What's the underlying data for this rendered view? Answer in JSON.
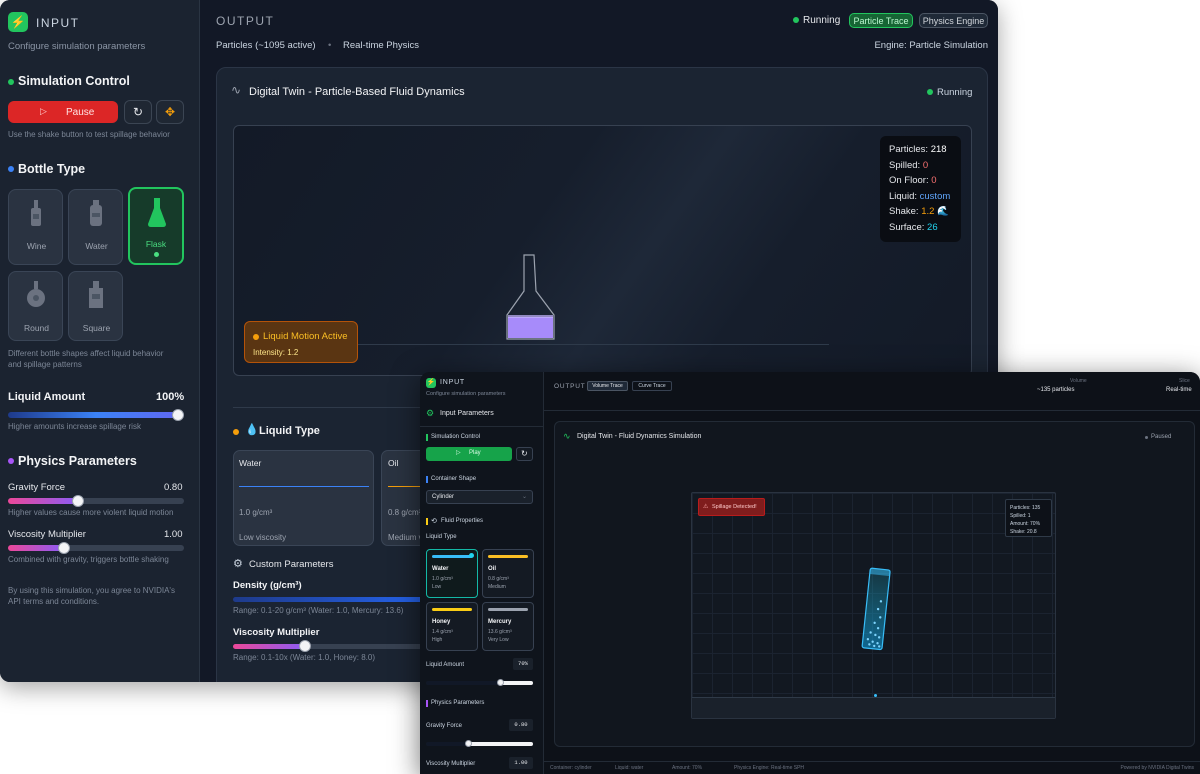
{
  "winA": {
    "sidebar": {
      "title": "INPUT",
      "subtitle": "Configure simulation parameters",
      "sim_control": {
        "heading": "Simulation Control",
        "pause_label": "Pause",
        "hint": "Use the shake button to test spillage behavior"
      },
      "bottle_type": {
        "heading": "Bottle Type",
        "items": [
          {
            "label": "Wine",
            "selected": false
          },
          {
            "label": "Water",
            "selected": false
          },
          {
            "label": "Flask",
            "selected": true
          },
          {
            "label": "Round",
            "selected": false
          },
          {
            "label": "Square",
            "selected": false
          }
        ],
        "hint_line1": "Different bottle shapes affect liquid behavior",
        "hint_line2": "and spillage patterns"
      },
      "liquid_amount": {
        "label": "Liquid Amount",
        "value": "100%",
        "fraction": 1.0,
        "hint": "Higher amounts increase spillage risk"
      },
      "physics": {
        "heading": "Physics Parameters",
        "gravity_label": "Gravity Force",
        "gravity_value": "0.80",
        "gravity_fraction": 0.4,
        "gravity_hint": "Higher values cause more violent liquid motion",
        "viscosity_label": "Viscosity Multiplier",
        "viscosity_value": "1.00",
        "viscosity_fraction": 0.32,
        "viscosity_hint": "Combined with gravity, triggers bottle shaking"
      },
      "terms_line1": "By using this simulation, you agree to NVIDIA's",
      "terms_line2": "API terms and conditions."
    },
    "main": {
      "title": "OUTPUT",
      "status": "Running",
      "tab_particle_trace": "Particle Trace",
      "tab_physics_engine": "Physics Engine",
      "particles_info": "Particles (~1095 active)",
      "separator": "•",
      "realtime": "Real-time Physics",
      "engine": "Engine: Particle Simulation",
      "panel_title": "Digital Twin - Particle-Based Fluid Dynamics",
      "panel_status": "Running",
      "stats": {
        "particles_label": "Particles:",
        "particles_value": "218",
        "spilled_label": "Spilled:",
        "spilled_value": "0",
        "floor_label": "On Floor:",
        "floor_value": "0",
        "liquid_label": "Liquid:",
        "liquid_value": "custom",
        "shake_label": "Shake:",
        "shake_value": "1.2",
        "shake_icon": "🌊",
        "surface_label": "Surface:",
        "surface_value": "26"
      },
      "motion_title": "Liquid Motion Active",
      "motion_intensity": "Intensity: 1.2",
      "liquid_type_heading": "Liquid Type",
      "liquids": [
        {
          "name": "Water",
          "density": "1.0 g/cm³",
          "viscosity": "Low viscosity",
          "color": "#3b82f6"
        },
        {
          "name": "Oil",
          "density": "0.8 g/cm³",
          "viscosity": "Medium v",
          "color": "#f59e0b"
        }
      ],
      "custom_heading": "Custom Parameters",
      "density_label": "Density (g/cm³)",
      "density_range": "Range: 0.1-20 g/cm³ (Water: 1.0, Mercury: 13.6)",
      "visc_label": "Viscosity Multiplier",
      "visc_range": "Range: 0.1-10x (Water: 1.0, Honey: 8.0)"
    }
  },
  "winB": {
    "sidebar": {
      "title": "INPUT",
      "subtitle": "Configure simulation parameters",
      "input_params": "Input Parameters",
      "sim_control": "Simulation Control",
      "play_label": "Play",
      "container_shape": "Container Shape",
      "shape_value": "Cylinder",
      "fluid_properties": "Fluid Properties",
      "liquid_type": "Liquid Type",
      "liquids": [
        {
          "name": "Water",
          "density": "1.0 g/cm³",
          "viscosity": "Low",
          "color": "#38bdf8",
          "selected": true
        },
        {
          "name": "Oil",
          "density": "0.8 g/cm³",
          "viscosity": "Medium",
          "color": "#fbbf24",
          "selected": false
        },
        {
          "name": "Honey",
          "density": "1.4 g/cm³",
          "viscosity": "High",
          "color": "#facc15",
          "selected": false
        },
        {
          "name": "Mercury",
          "density": "13.6 g/cm³",
          "viscosity": "Very Low",
          "color": "#9ca3af",
          "selected": false
        }
      ],
      "liquid_amount": "Liquid Amount",
      "liquid_amount_value": "70%",
      "liquid_amount_fraction": 0.7,
      "physics_params": "Physics Parameters",
      "gravity_label": "Gravity Force",
      "gravity_value": "0.80",
      "gravity_fraction": 0.4,
      "viscosity_label": "Viscosity Multiplier",
      "viscosity_value": "1.00"
    },
    "main": {
      "title": "OUTPUT",
      "tab_volume": "Volume Trace",
      "tab_curve": "Curve Trace",
      "volume_label": "Volume",
      "volume_value": "~135 particles",
      "slice_label": "Slice",
      "slice_value": "Real-time",
      "panel_title": "Digital Twin - Fluid Dynamics Simulation",
      "panel_status": "Paused",
      "spillage": "Spillage Detected!",
      "stats": [
        "Particles: 135",
        "Spilled: 1",
        "Amount: 70%",
        "Shake: 20.8"
      ],
      "footer": {
        "container": "Container: cylinder",
        "liquid": "Liquid: water",
        "amount": "Amount: 70%",
        "engine": "Physics Engine: Real-time SPH",
        "powered": "Powered by NVIDIA Digital Twins"
      }
    }
  },
  "colors": {
    "accent_green": "#22c55e",
    "pause_red": "#dc2626",
    "orange": "#f59e0b",
    "cyan": "#22d3ee",
    "purple_liquid": "#a78bfa"
  }
}
